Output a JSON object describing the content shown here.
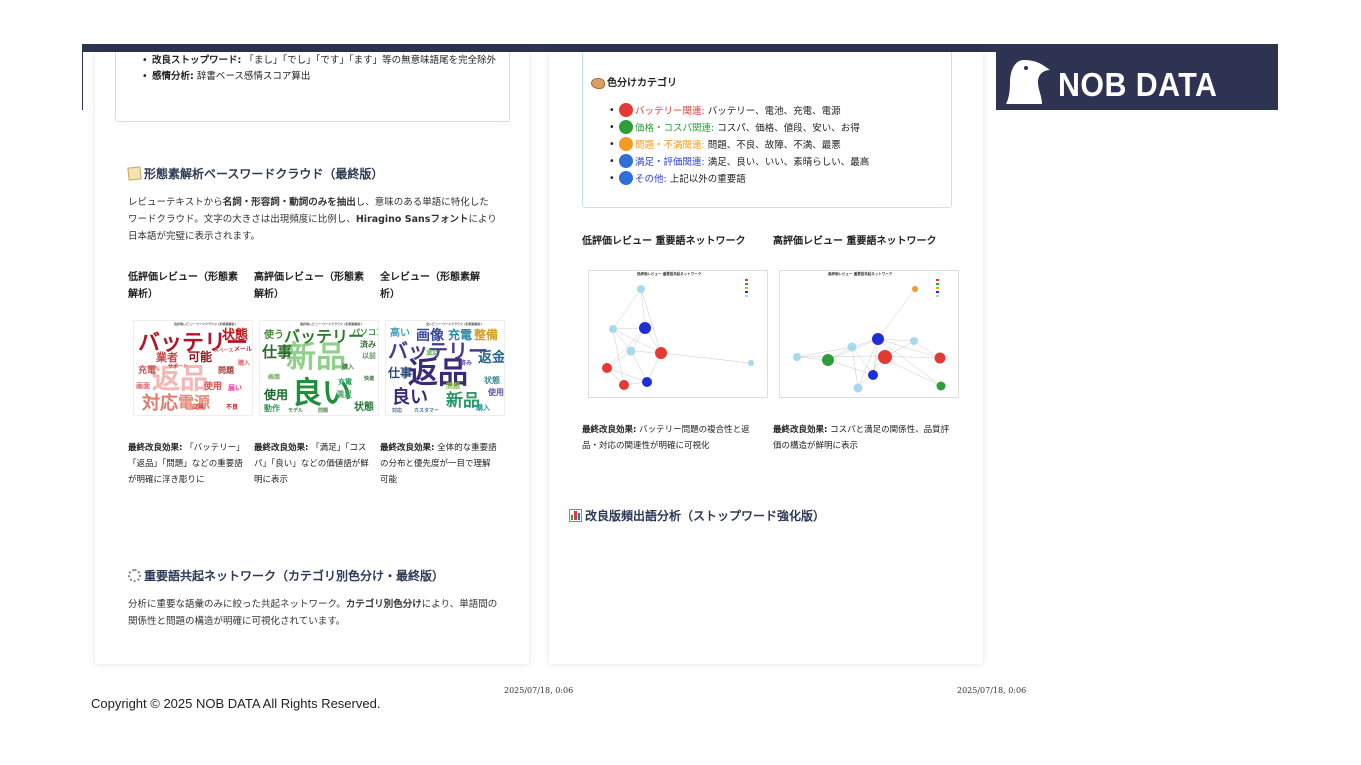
{
  "brand": {
    "logo_text": "NOB DATA"
  },
  "left_page": {
    "stopword_item": {
      "label": "改良ストップワード:",
      "text": "「まし」「でし」「です」「ます」等の無意味語尾を完全除外"
    },
    "sentiment_item": {
      "label": "感情分析:",
      "text": "辞書ベース感情スコア算出"
    },
    "wordcloud_section": {
      "title": "形態素解析ベースワードクラウド（最終版）",
      "desc_1": "レビューテキストから",
      "desc_bold_1": "名詞・形容詞・動詞のみを抽出",
      "desc_2": "し、意味のある単語に特化したワードクラウド。文字の大きさは出現頻度に比例し、",
      "desc_bold_2": "Hiragino Sansフォント",
      "desc_3": "により日本語が完璧に表示されます。",
      "columns": [
        {
          "heading": "低評価レビュー（形態素解析）",
          "effect_label": "最終改良効果:",
          "effect_text": "「バッテリー」「返品」「問題」などの重要語が明確に浮き彫りに",
          "cloud_caption": "低評価レビュー ワードクラウド (形態素解析)",
          "words": [
            "バッテリー",
            "返品",
            "対応",
            "電源",
            "状態",
            "可能",
            "業者",
            "使用",
            "問題",
            "充電",
            "届い",
            "サポート",
            "スペース",
            "メール",
            "画面",
            "交換",
            "不良",
            "購入"
          ]
        },
        {
          "heading": "高評価レビュー（形態素解析）",
          "effect_label": "最終改良効果:",
          "effect_text": "「満足」「コスパ」「良い」などの価値語が鮮明に表示",
          "cloud_caption": "高評価レビュー ワードクラウド (形態素解析)",
          "words": [
            "新品",
            "良い",
            "バッテリー",
            "仕事",
            "使用",
            "使う",
            "パソコン",
            "充電",
            "満足",
            "状態",
            "済み",
            "以前",
            "動作",
            "購入",
            "画面",
            "モデル",
            "問題",
            "快適"
          ]
        },
        {
          "heading": "全レビュー（形態素解析）",
          "effect_label": "最終改良効果:",
          "effect_text": "全体的な重要語の分布と優先度が一目で理解可能",
          "cloud_caption": "全レビュー ワードクラウド (形態素解析)",
          "words": [
            "バッテリー",
            "返品",
            "新品",
            "画像",
            "充電",
            "整備",
            "良い",
            "仕事",
            "返金",
            "高い",
            "状態",
            "問題",
            "使用",
            "購入",
            "カスタマー",
            "満足",
            "済み",
            "対応"
          ]
        }
      ]
    },
    "network_section": {
      "title": "重要語共起ネットワーク（カテゴリ別色分け・最終版）",
      "desc_1": "分析に重要な語彙のみに絞った共起ネットワーク。",
      "desc_bold": "カテゴリ別色分け",
      "desc_2": "により、単語間の関係性と問題の構造が明確に可視化されています。"
    },
    "date": "2025/07/18, 0:06"
  },
  "right_page": {
    "color_category": {
      "title": "色分けカテゴリ",
      "items": [
        {
          "label": "バッテリー関連:",
          "text": "バッテリー、電池、充電、電源",
          "color": "#e53935"
        },
        {
          "label": "価格・コスパ関連:",
          "text": "コスパ、価格、値段、安い、お得",
          "color": "#2e9e3a"
        },
        {
          "label": "問題・不満関連:",
          "text": "問題、不良、故障、不満、最悪",
          "color": "#f59a23"
        },
        {
          "label": "満足・評価関連:",
          "text": "満足、良い、いい、素晴らしい、最高",
          "color": "#2f3fd6"
        },
        {
          "label": "その他:",
          "text": "上記以外の重要語",
          "color": "#2f3fd6"
        }
      ]
    },
    "networks": [
      {
        "heading": "低評価レビュー 重要語ネットワーク",
        "caption": "低評価レビュー 重要語共起ネットワーク",
        "effect_label": "最終改良効果:",
        "effect_text": "バッテリー問題の複合性と返品・対応の関連性が明確に可視化"
      },
      {
        "heading": "高評価レビュー 重要語ネットワーク",
        "caption": "高評価レビュー 重要語共起ネットワーク",
        "effect_label": "最終改良効果:",
        "effect_text": "コスパと満足の関係性、品質評価の構造が鮮明に表示"
      }
    ],
    "freq_title": "改良版頻出語分析（ストップワード強化版）",
    "date": "2025/07/18, 0:06"
  },
  "footer": {
    "copyright": "Copyright © 2025 NOB DATA All Rights Reserved."
  }
}
